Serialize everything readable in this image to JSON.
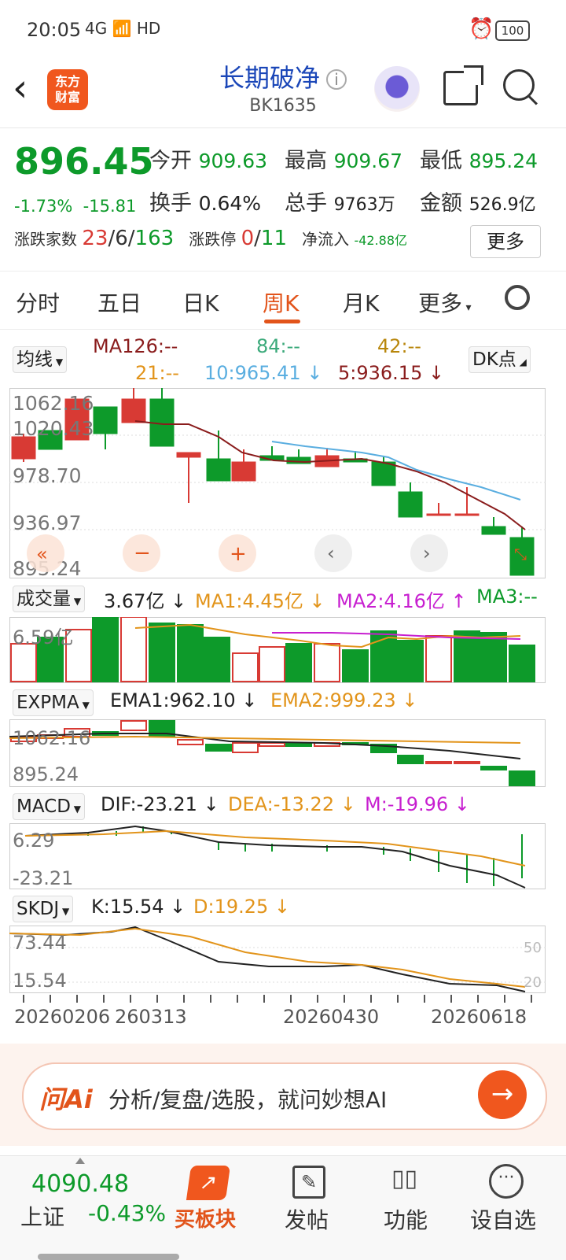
{
  "status": {
    "time": "20:05",
    "network": "4G 📶 HD",
    "battery": "100"
  },
  "header": {
    "title": "长期破净",
    "code": "BK1635",
    "logo_text": "东方财富"
  },
  "quote": {
    "price": "896.45",
    "change_pct": "-1.73%",
    "change_val": "-15.81",
    "open_label": "今开",
    "open": "909.63",
    "high_label": "最高",
    "high": "909.67",
    "low_label": "最低",
    "low": "895.24",
    "turnover_label": "换手",
    "turnover": "0.64%",
    "volume_label": "总手",
    "volume": "9763万",
    "amount_label": "金额",
    "amount": "526.9亿",
    "rise_fall_label": "涨跌家数",
    "rise": "23",
    "flat": "6",
    "fall": "163",
    "limit_label": "涨跌停",
    "limit_up": "0",
    "limit_down": "11",
    "inflow_label": "净流入",
    "inflow": "-42.88亿",
    "more": "更多"
  },
  "tabs": [
    {
      "label": "分时"
    },
    {
      "label": "五日"
    },
    {
      "label": "日K"
    },
    {
      "label": "周K"
    },
    {
      "label": "月K"
    },
    {
      "label": "更多"
    }
  ],
  "ma": {
    "select": "均线",
    "ma126": "MA126:--",
    "ma84": "84:--",
    "ma42": "42:--",
    "ma21": "21:--",
    "ma10": "10:965.41 ↓",
    "ma5": "5:936.15 ↓",
    "dk": "DK点"
  },
  "axis": {
    "k1": "1062.16",
    "k2": "1020.43",
    "k3": "978.70",
    "k4": "936.97",
    "k5": "895.24",
    "v1": "6.59亿",
    "e1": "1062.16",
    "e2": "895.24",
    "m1": "6.29",
    "m2": "-23.21",
    "s1": "73.44",
    "s2": "15.54",
    "s3": "50",
    "s4": "20"
  },
  "volume": {
    "select": "成交量",
    "val": "3.67亿 ↓",
    "ma1": "MA1:4.45亿 ↓",
    "ma2": "MA2:4.16亿 ↑",
    "ma3": "MA3:--"
  },
  "expma": {
    "select": "EXPMA",
    "ema1": "EMA1:962.10 ↓",
    "ema2": "EMA2:999.23 ↓"
  },
  "macd": {
    "select": "MACD",
    "dif": "DIF:-23.21 ↓",
    "dea": "DEA:-13.22 ↓",
    "m": "M:-19.96 ↓"
  },
  "skdj": {
    "select": "SKDJ",
    "k": "K:15.54 ↓",
    "d": "D:19.25 ↓"
  },
  "dates": {
    "d1": "20260206",
    "d2": "260313",
    "d3": "20260430",
    "d4": "20260618"
  },
  "ai": {
    "brand": "问Ai",
    "prompt": "分析/复盘/选股，就问妙想AI"
  },
  "bottom": {
    "index_value": "4090.48",
    "index_name": "上证",
    "index_chg": "-0.43%",
    "buy": "买板块",
    "post": "发帖",
    "func": "功能",
    "watch": "设自选"
  },
  "colors": {
    "up": "#d83a34",
    "down": "#0d9a2a",
    "accent": "#e2541b",
    "title": "#1a46b8"
  }
}
